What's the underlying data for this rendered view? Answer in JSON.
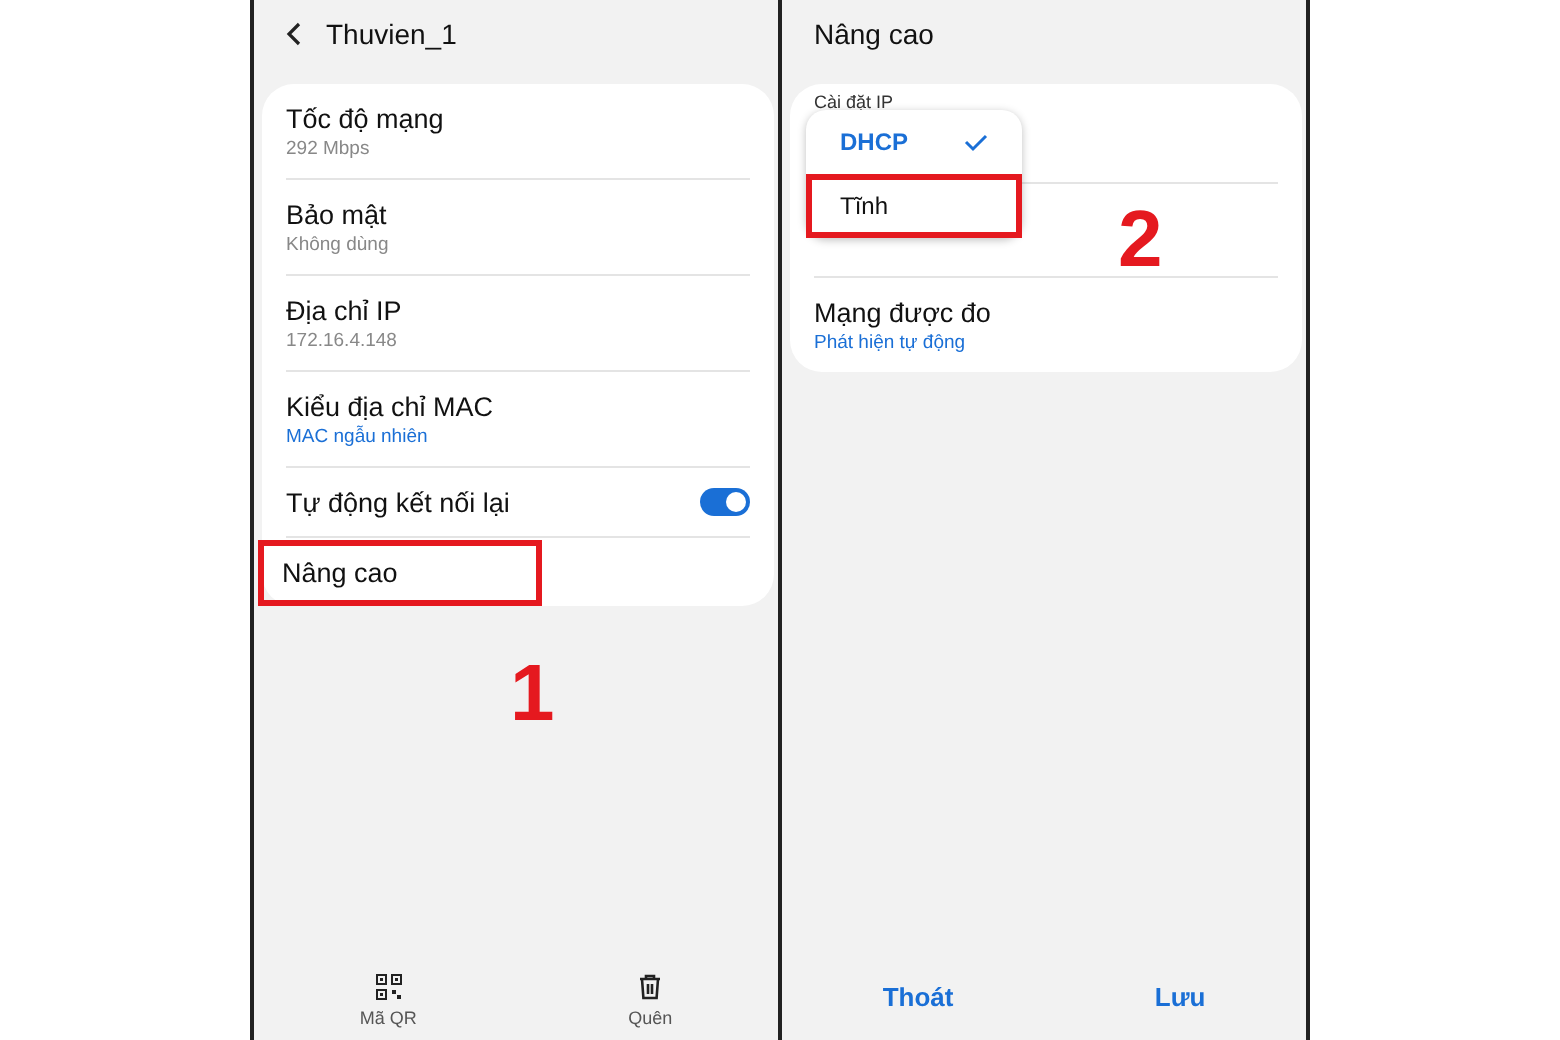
{
  "left_screen": {
    "title": "Thuvien_1",
    "settings": [
      {
        "kind": "info",
        "label": "Tốc độ mạng",
        "value": "292 Mbps",
        "highlighted": false
      },
      {
        "kind": "info",
        "label": "Bảo mật",
        "value": "Không dùng",
        "highlighted": false
      },
      {
        "kind": "info",
        "label": "Địa chỉ IP",
        "value": "172.16.4.148",
        "highlighted": false
      },
      {
        "kind": "link",
        "label": "Kiểu địa chỉ MAC",
        "value": "MAC ngẫu nhiên",
        "highlighted": false
      },
      {
        "kind": "toggle",
        "label": "Tự động kết nối lại",
        "on": true,
        "highlighted": false
      },
      {
        "kind": "plain",
        "label": "Nâng cao",
        "highlighted": true
      }
    ],
    "bottom_actions": [
      "Mã QR",
      "Quên"
    ],
    "step_number": "1"
  },
  "right_screen": {
    "title": "Nâng cao",
    "ip_setting": {
      "label": "Cài đặt IP",
      "options": [
        {
          "label": "DHCP",
          "selected": true,
          "highlighted": false
        },
        {
          "label": "Tĩnh",
          "selected": false,
          "highlighted": true
        }
      ]
    },
    "settings": [
      {
        "label": "Mạng được đo",
        "value": "Phát hiện tự động"
      }
    ],
    "buttons": [
      "Thoát",
      "Lưu"
    ],
    "step_number": "2"
  }
}
